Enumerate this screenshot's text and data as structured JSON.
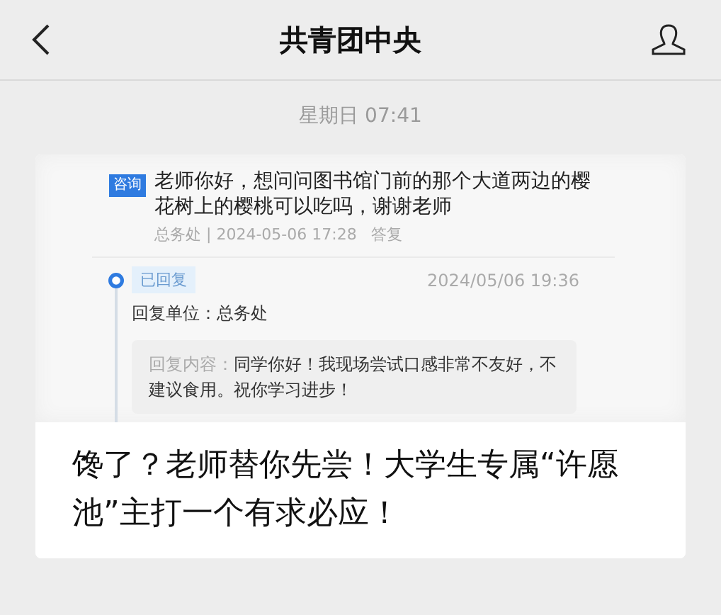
{
  "header": {
    "title": "共青团中央"
  },
  "timestamp": "星期日 07:41",
  "card": {
    "question": {
      "tag": "咨询",
      "text": "老师你好，想问问图书馆门前的那个大道两边的樱花树上的樱桃可以吃吗，谢谢老师",
      "meta": "总务处 | 2024-05-06 17:28",
      "action": "答复"
    },
    "reply": {
      "status": "已回复",
      "date": "2024/05/06 19:36",
      "unit": "回复单位：总务处",
      "label": "回复内容：",
      "content": "同学你好！我现场尝试口感非常不友好，不建议食用。祝你学习进步！"
    },
    "headline": "馋了？老师替你先尝！大学生专属“许愿池”主打一个有求必应！"
  }
}
